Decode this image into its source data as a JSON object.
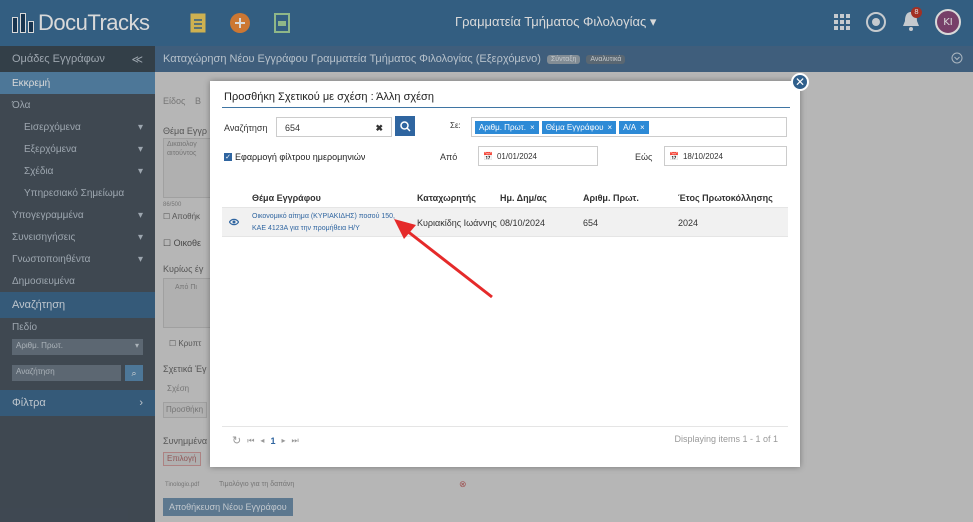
{
  "app": {
    "logo": "DocuTracks",
    "title": "Γραμματεία Τμήματος Φιλολογίας ▾",
    "avatar_initials": "ΚΙ",
    "notification_count": "8"
  },
  "sidebar": {
    "header": "Ομάδες Εγγράφων",
    "collapse": "≪",
    "items": [
      {
        "label": "Εκκρεμή",
        "cls": "active",
        "chev": ""
      },
      {
        "label": "Όλα",
        "cls": "",
        "chev": ""
      },
      {
        "label": "Εισερχόμενα",
        "cls": "sub",
        "chev": "▾"
      },
      {
        "label": "Εξερχόμενα",
        "cls": "sub",
        "chev": "▾"
      },
      {
        "label": "Σχέδια",
        "cls": "sub",
        "chev": "▾"
      },
      {
        "label": "Υπηρεσιακό Σημείωμα",
        "cls": "sub",
        "chev": ""
      },
      {
        "label": "Υπογεγραμμένα",
        "cls": "",
        "chev": "▾"
      },
      {
        "label": "Συνεισηγήσεις",
        "cls": "",
        "chev": "▾"
      },
      {
        "label": "Γνωστοποιηθέντα",
        "cls": "",
        "chev": "▾"
      },
      {
        "label": "Δημοσιευμένα",
        "cls": "",
        "chev": ""
      }
    ],
    "search_section": "Αναζήτηση",
    "field_label": "Πεδίο",
    "field_value": "Αριθμ. Πρωτ.",
    "search_placeholder": "Αναζήτηση",
    "filters": "Φίλτρα"
  },
  "main": {
    "header": "Καταχώρηση Νέου Εγγράφου Γραμματεία Τμήματος Φιλολογίας (Εξερχόμενο)",
    "pill1": "Σύνταξη",
    "pill2": "Αναλυτικά",
    "bg": {
      "tab_eidos": "Είδος",
      "tab_b": "Β",
      "thema": "Θέμα Εγγρ",
      "desc1": "Δικαιολογ",
      "desc2": "αιτούντος",
      "counter": "86/500",
      "chk1": "☐ Αποθήκ",
      "chk2": "☐ Οικοθε",
      "kyrios": "Κυρίως έγ",
      "apo": "Από Πι",
      "kryf": "☐ Κρυπτ",
      "sxetika": "Σχετικά Έγ",
      "sxesi": "Σχέση",
      "prosthiki": "Προσθήκη",
      "synimmena": "Συνημμένα",
      "epilogi": "Επιλογή",
      "file": "Tinologio.pdf",
      "file_desc": "Τιμολόγιο για τη δαπάνη",
      "save": "Αποθήκευση Νέου Εγγράφου"
    }
  },
  "modal": {
    "title": "Προσθήκη Σχετικού με σχέση : Άλλη σχέση",
    "search_label": "Αναζήτηση",
    "search_value": "654",
    "in_label": "Σε:",
    "tags": [
      "Αριθμ. Πρωτ.",
      "Θέμα Εγγράφου",
      "Α/Α"
    ],
    "date_filter_label": "Εφαρμογή φίλτρου ημερομηνιών",
    "from_label": "Από",
    "from_value": "01/01/2024",
    "to_label": "Εώς",
    "to_value": "18/10/2024",
    "columns": {
      "subject": "Θέμα Εγγράφου",
      "registrar": "Καταχωρητής",
      "date": "Ημ. Δημ/ας",
      "protocol": "Αριθμ. Πρωτ.",
      "year": "Έτος Πρωτοκόλλησης"
    },
    "row": {
      "subject_line1": "Οικονομικό αίτημα (ΚΥΡΙΑΚΙΔΗΣ) ποσού 150,",
      "subject_line2": "ΚΑΕ 4123Α για την προμήθεια Η/Υ",
      "registrar": "Κυριακίδης Ιωάννης",
      "date": "08/10/2024",
      "protocol": "654",
      "year": "2024"
    },
    "pager": {
      "refresh": "↻",
      "first": "⏮",
      "prev": "◂",
      "page": "1",
      "next": "▸",
      "last": "⏭"
    },
    "display_info": "Displaying items 1 - 1 of 1"
  }
}
